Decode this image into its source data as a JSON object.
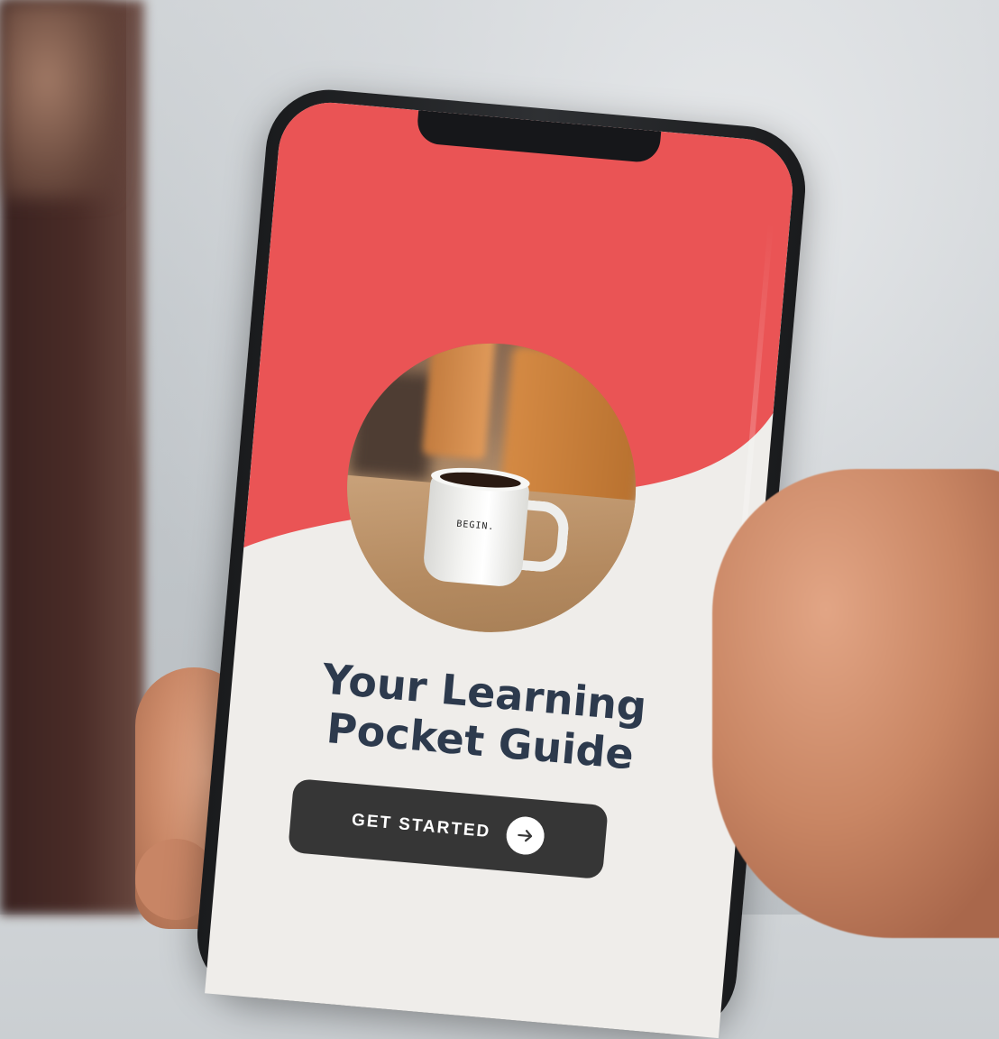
{
  "app": {
    "headline_line1": "Your Learning",
    "headline_line2": "Pocket Guide",
    "cta_label": "GET STARTED",
    "cta_icon": "arrow-right-icon",
    "mug_text": "BEGIN."
  },
  "colors": {
    "accent": "#EA5455",
    "background": "#EFEDEA",
    "title_text": "#2D3A4D",
    "button_bg": "#363636",
    "button_text": "#FFFFFF"
  }
}
